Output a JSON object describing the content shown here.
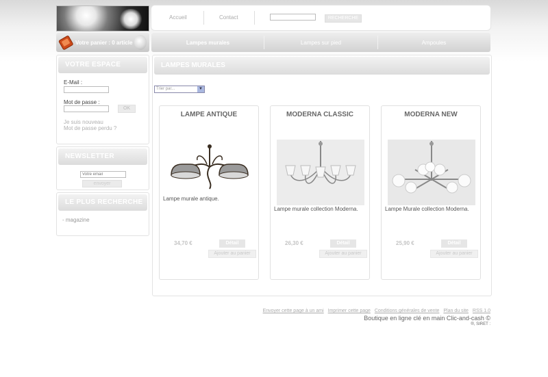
{
  "header": {
    "nav": [
      "Accueil",
      "Contact"
    ],
    "search_placeholder": "",
    "search_button": "RECHERCHE"
  },
  "cart": {
    "text": "Votre panier : 0 article"
  },
  "categories": [
    "Lampes murales",
    "Lampes sur pied",
    "Ampoules"
  ],
  "sidebar": {
    "space": {
      "title": "VOTRE ESPACE",
      "email_label": "E-Mail :",
      "password_label": "Mot de passe :",
      "ok_button": "OK",
      "new_link": "Je suis nouveau",
      "lost_link": "Mot de passe perdu ?"
    },
    "newsletter": {
      "title": "NEWSLETTER",
      "input_placeholder": "Votre email",
      "button": "envoyer"
    },
    "popular": {
      "title": "LE PLUS RECHERCHE",
      "items": [
        "- magazine"
      ]
    }
  },
  "main": {
    "title": "LAMPES MURALES",
    "sort_label": "Trier par..."
  },
  "products": [
    {
      "name": "LAMPE ANTIQUE",
      "desc": "Lampe murale antique.",
      "price": "34,70 €",
      "detail": "Détail",
      "add": "Ajouter au panier"
    },
    {
      "name": "MODERNA CLASSIC",
      "desc": "Lampe murale collection Moderna.",
      "price": "26,30 €",
      "detail": "Détail",
      "add": "Ajouter au panier"
    },
    {
      "name": "MODERNA NEW",
      "desc": "Lampe Murale collection Moderna.",
      "price": "25,90 €",
      "detail": "Détail",
      "add": "Ajouter au panier"
    }
  ],
  "footer": {
    "links": [
      "Envoyer cette page à un ami",
      "Imprimer cette page",
      "Conditions générales de vente",
      "Plan du site",
      "RSS 1.0"
    ],
    "tagline": "Boutique en ligne clé en main Clic-and-cash ©",
    "small": "®, SIRET :"
  },
  "colors": {
    "panel_grey": "#dcdcdc",
    "cart_icon": "#cc4a1a"
  }
}
